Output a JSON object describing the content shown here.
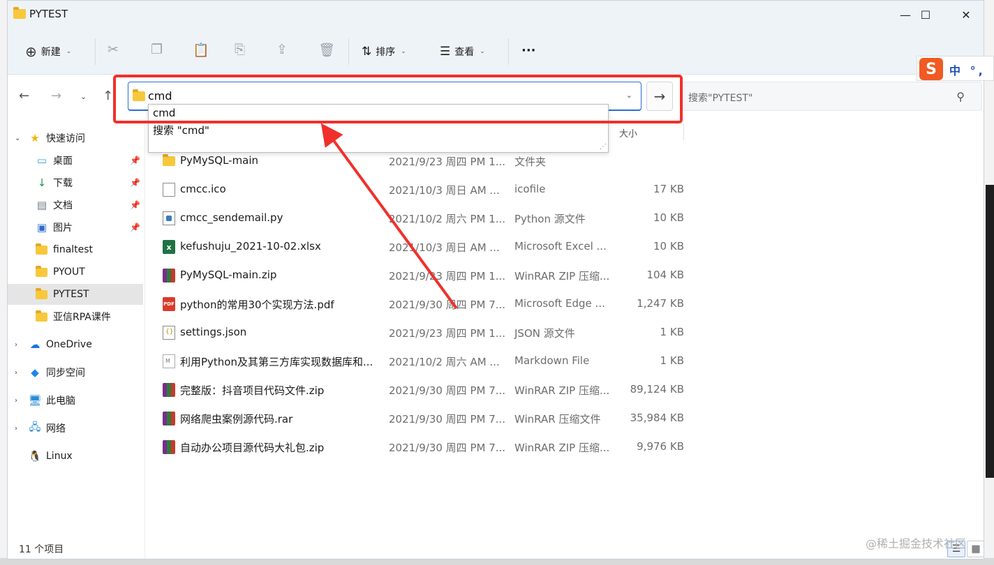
{
  "window": {
    "title": "PYTEST",
    "minimize_glyph": "—",
    "maximize_glyph": "☐",
    "close_glyph": "✕"
  },
  "toolbar": {
    "new_label": "新建",
    "sort_label": "排序",
    "view_label": "查看",
    "more_label": "···"
  },
  "address": {
    "value": "cmd",
    "go_glyph": "→"
  },
  "search": {
    "placeholder": "搜索\"PYTEST\""
  },
  "autocomplete": {
    "items": [
      "cmd",
      "搜索 \"cmd\""
    ]
  },
  "sidebar": {
    "items": [
      {
        "label": "快速访问",
        "icon": "star-icon"
      },
      {
        "label": "桌面",
        "icon": "desktop-icon"
      },
      {
        "label": "下载",
        "icon": "download-icon"
      },
      {
        "label": "文档",
        "icon": "document-icon"
      },
      {
        "label": "图片",
        "icon": "picture-icon"
      },
      {
        "label": "finaltest",
        "icon": "folder-icon"
      },
      {
        "label": "PYOUT",
        "icon": "folder-icon"
      },
      {
        "label": "PYTEST",
        "icon": "folder-icon"
      },
      {
        "label": "亚信RPA课件",
        "icon": "folder-icon"
      },
      {
        "label": "OneDrive",
        "icon": "cloud-icon"
      },
      {
        "label": "同步空间",
        "icon": "sync-icon"
      },
      {
        "label": "此电脑",
        "icon": "computer-icon"
      },
      {
        "label": "网络",
        "icon": "network-icon"
      },
      {
        "label": "Linux",
        "icon": "linux-icon"
      }
    ]
  },
  "columns": {
    "size": "大小"
  },
  "files": [
    {
      "name": "PyMySQL-main",
      "date": "2021/9/23 周四 PM 1...",
      "type": "文件夹",
      "size": "",
      "icon": "folder"
    },
    {
      "name": "cmcc.ico",
      "date": "2021/10/3 周日 AM ...",
      "type": "icofile",
      "size": "17 KB",
      "icon": "doc"
    },
    {
      "name": "cmcc_sendemail.py",
      "date": "2021/10/2 周六 PM 1...",
      "type": "Python 源文件",
      "size": "10 KB",
      "icon": "py"
    },
    {
      "name": "kefushuju_2021-10-02.xlsx",
      "date": "2021/10/3 周日 AM ...",
      "type": "Microsoft Excel ...",
      "size": "10 KB",
      "icon": "xls"
    },
    {
      "name": "PyMySQL-main.zip",
      "date": "2021/9/23 周四 PM 1...",
      "type": "WinRAR ZIP 压缩...",
      "size": "104 KB",
      "icon": "rar"
    },
    {
      "name": "python的常用30个实现方法.pdf",
      "date": "2021/9/30 周四 PM 7...",
      "type": "Microsoft Edge ...",
      "size": "1,247 KB",
      "icon": "pdf"
    },
    {
      "name": "settings.json",
      "date": "2021/9/23 周四 PM 1...",
      "type": "JSON 源文件",
      "size": "1 KB",
      "icon": "json"
    },
    {
      "name": "利用Python及其第三方库实现数据库和...",
      "date": "2021/10/2 周六 AM ...",
      "type": "Markdown File",
      "size": "1 KB",
      "icon": "md"
    },
    {
      "name": "完整版：抖音项目代码文件.zip",
      "date": "2021/9/30 周四 PM 7...",
      "type": "WinRAR ZIP 压缩...",
      "size": "89,124 KB",
      "icon": "rar"
    },
    {
      "name": "网络爬虫案例源代码.rar",
      "date": "2021/9/30 周四 PM 7...",
      "type": "WinRAR 压缩文件",
      "size": "35,984 KB",
      "icon": "rar"
    },
    {
      "name": "自动办公项目源代码大礼包.zip",
      "date": "2021/9/30 周四 PM 7...",
      "type": "WinRAR ZIP 压缩...",
      "size": "9,976 KB",
      "icon": "rar"
    }
  ],
  "status": {
    "count": "11 个项目"
  },
  "ime": {
    "logo": "S",
    "text": "中 °,"
  },
  "watermark": "@稀土掘金技术社区",
  "colors": {
    "annotation_red": "#f0302b",
    "accent_blue": "#2b6fd1",
    "selected_bg": "#e5e5e5"
  }
}
